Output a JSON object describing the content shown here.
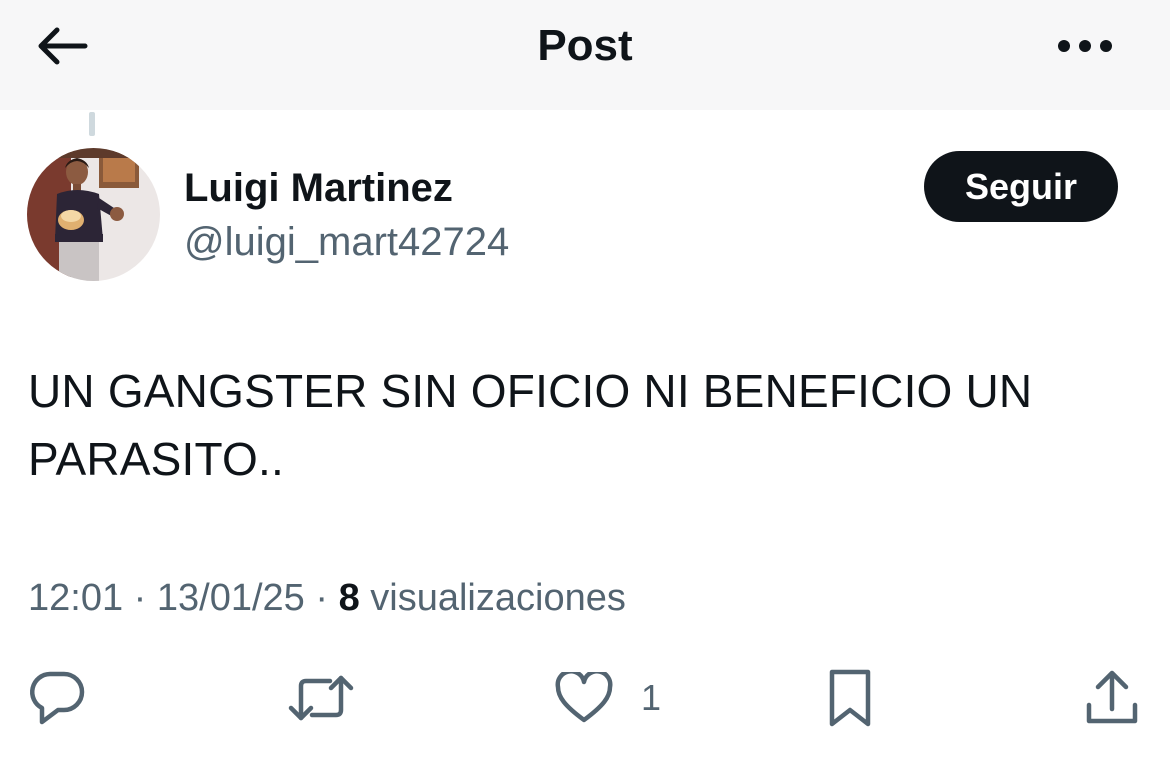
{
  "header": {
    "title": "Post",
    "back_icon": "arrow-left-icon",
    "more_icon": "more-horizontal-icon"
  },
  "author": {
    "display_name": "Luigi Martinez",
    "handle": "@luigi_mart42724",
    "follow_label": "Seguir"
  },
  "post": {
    "text": "UN GANGSTER SIN OFICIO NI BENEFICIO UN PARASITO..",
    "time": "12:01",
    "date": "13/01/25",
    "views_count": "8",
    "views_label": "visualizaciones",
    "separator": "·"
  },
  "actions": {
    "reply_icon": "reply-icon",
    "repost_icon": "repost-icon",
    "like_icon": "heart-icon",
    "like_count": "1",
    "bookmark_icon": "bookmark-icon",
    "share_icon": "share-icon"
  },
  "colors": {
    "text_primary": "#0f1419",
    "text_secondary": "#536471",
    "header_bg": "#f7f7f8",
    "button_bg": "#0f1419"
  }
}
